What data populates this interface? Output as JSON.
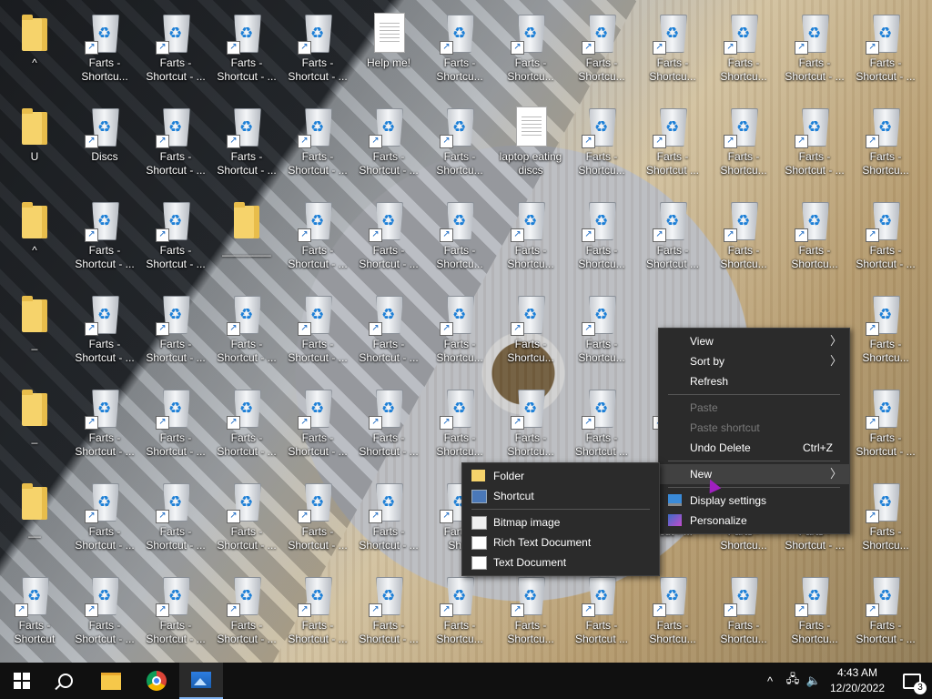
{
  "desktop": {
    "rows": [
      [
        {
          "type": "folder",
          "label": "^"
        },
        {
          "type": "bin",
          "label": "Farts -\nShortcu..."
        },
        {
          "type": "bin",
          "label": "Farts -\nShortcut - ..."
        },
        {
          "type": "bin",
          "label": "Farts -\nShortcut - ..."
        },
        {
          "type": "bin",
          "label": "Farts -\nShortcut - ..."
        },
        {
          "type": "doc",
          "label": "Help me!"
        },
        {
          "type": "bin",
          "label": "Farts -\nShortcu..."
        },
        {
          "type": "bin",
          "label": "Farts -\nShortcu..."
        },
        {
          "type": "bin",
          "label": "Farts -\nShortcu..."
        },
        {
          "type": "bin",
          "label": "Farts -\nShortcu..."
        },
        {
          "type": "bin",
          "label": "Farts -\nShortcu..."
        },
        {
          "type": "bin",
          "label": "Farts -\nShortcut - ..."
        },
        {
          "type": "bin",
          "label": "Farts -\nShortcut - ..."
        }
      ],
      [
        {
          "type": "folder",
          "label": "U"
        },
        {
          "type": "bin",
          "label": "Discs"
        },
        {
          "type": "bin",
          "label": "Farts -\nShortcut - ..."
        },
        {
          "type": "bin",
          "label": "Farts -\nShortcut - ..."
        },
        {
          "type": "bin",
          "label": "Farts -\nShortcut - ..."
        },
        {
          "type": "bin",
          "label": "Farts -\nShortcut - ..."
        },
        {
          "type": "bin",
          "label": "Farts -\nShortcu..."
        },
        {
          "type": "doc",
          "label": "laptop eating\ndiscs"
        },
        {
          "type": "bin",
          "label": "Farts -\nShortcu..."
        },
        {
          "type": "bin",
          "label": "Farts -\nShortcut ..."
        },
        {
          "type": "bin",
          "label": "Farts -\nShortcu..."
        },
        {
          "type": "bin",
          "label": "Farts -\nShortcut - ..."
        },
        {
          "type": "bin",
          "label": "Farts -\nShortcu..."
        }
      ],
      [
        {
          "type": "folder",
          "label": "^"
        },
        {
          "type": "bin",
          "label": "Farts -\nShortcut - ..."
        },
        {
          "type": "bin",
          "label": "Farts -\nShortcut - ..."
        },
        {
          "type": "folder",
          "label": "________"
        },
        {
          "type": "bin",
          "label": "Farts -\nShortcut - ..."
        },
        {
          "type": "bin",
          "label": "Farts -\nShortcut - ..."
        },
        {
          "type": "bin",
          "label": "Farts -\nShortcu..."
        },
        {
          "type": "bin",
          "label": "Farts -\nShortcu..."
        },
        {
          "type": "bin",
          "label": "Farts -\nShortcu..."
        },
        {
          "type": "bin",
          "label": "Farts -\nShortcut ..."
        },
        {
          "type": "bin",
          "label": "Farts -\nShortcu..."
        },
        {
          "type": "bin",
          "label": "Farts -\nShortcu..."
        },
        {
          "type": "bin",
          "label": "Farts -\nShortcut - ..."
        }
      ],
      [
        {
          "type": "folder",
          "label": "_"
        },
        {
          "type": "bin",
          "label": "Farts -\nShortcut - ..."
        },
        {
          "type": "bin",
          "label": "Farts -\nShortcut - ..."
        },
        {
          "type": "bin",
          "label": "Farts -\nShortcut - ..."
        },
        {
          "type": "bin",
          "label": "Farts -\nShortcut - ..."
        },
        {
          "type": "bin",
          "label": "Farts -\nShortcut - ..."
        },
        {
          "type": "bin",
          "label": "Farts -\nShortcu..."
        },
        {
          "type": "bin",
          "label": "Farts -\nShortcu..."
        },
        {
          "type": "bin",
          "label": "Farts -\nShortcu..."
        },
        null,
        null,
        null,
        {
          "type": "bin",
          "label": "Farts -\nShortcu..."
        }
      ],
      [
        {
          "type": "folder",
          "label": "_"
        },
        {
          "type": "bin",
          "label": "Farts -\nShortcut - ..."
        },
        {
          "type": "bin",
          "label": "Farts -\nShortcut - ..."
        },
        {
          "type": "bin",
          "label": "Farts -\nShortcut - ..."
        },
        {
          "type": "bin",
          "label": "Farts -\nShortcut - ..."
        },
        {
          "type": "bin",
          "label": "Farts -\nShortcut - ..."
        },
        {
          "type": "bin",
          "label": "Farts -\nShortcu..."
        },
        {
          "type": "bin",
          "label": "Farts -\nShortcu..."
        },
        {
          "type": "bin",
          "label": "Farts -\nShortcut ..."
        },
        {
          "type": "bin",
          "label": "S"
        },
        null,
        null,
        {
          "type": "bin",
          "label": "Farts -\nShortcut - ..."
        }
      ],
      [
        {
          "type": "folder",
          "label": "__"
        },
        {
          "type": "bin",
          "label": "Farts -\nShortcut - ..."
        },
        {
          "type": "bin",
          "label": "Farts -\nShortcut - ..."
        },
        {
          "type": "bin",
          "label": "Farts -\nShortcut - ..."
        },
        {
          "type": "bin",
          "label": "Farts -\nShortcut - ..."
        },
        {
          "type": "bin",
          "label": "Farts -\nShortcut - ..."
        },
        {
          "type": "bin",
          "label": "Farts -\nShor"
        },
        null,
        null,
        {
          "type": "bin",
          "label": "rtcut - ..."
        },
        {
          "type": "bin",
          "label": "Farts -\nShortcu..."
        },
        {
          "type": "bin",
          "label": "Farts -\nShortcut - ..."
        },
        {
          "type": "bin",
          "label": "Farts -\nShortcu..."
        }
      ],
      [
        {
          "type": "bin",
          "label": "Farts -\nShortcut"
        },
        {
          "type": "bin",
          "label": "Farts -\nShortcut - ..."
        },
        {
          "type": "bin",
          "label": "Farts -\nShortcut - ..."
        },
        {
          "type": "bin",
          "label": "Farts -\nShortcut - ..."
        },
        {
          "type": "bin",
          "label": "Farts -\nShortcut - ..."
        },
        {
          "type": "bin",
          "label": "Farts -\nShortcut - ..."
        },
        {
          "type": "bin",
          "label": "Farts -\nShortcu..."
        },
        {
          "type": "bin",
          "label": "Farts -\nShortcu..."
        },
        {
          "type": "bin",
          "label": "Farts -\nShortcut ..."
        },
        {
          "type": "bin",
          "label": "Farts -\nShortcu..."
        },
        {
          "type": "bin",
          "label": "Farts -\nShortcu..."
        },
        {
          "type": "bin",
          "label": "Farts -\nShortcu..."
        },
        {
          "type": "bin",
          "label": "Farts -\nShortcut - ..."
        }
      ]
    ]
  },
  "context_menu": {
    "view": "View",
    "sort_by": "Sort by",
    "refresh": "Refresh",
    "paste": "Paste",
    "paste_shortcut": "Paste shortcut",
    "undo_delete": "Undo Delete",
    "undo_shortcut": "Ctrl+Z",
    "new": "New",
    "display_settings": "Display settings",
    "personalize": "Personalize"
  },
  "new_submenu": {
    "folder": "Folder",
    "shortcut": "Shortcut",
    "bitmap": "Bitmap image",
    "rtf": "Rich Text Document",
    "text": "Text Document"
  },
  "taskbar": {
    "time": "4:43 AM",
    "date": "12/20/2022",
    "notification_count": "3",
    "tray_chevron": "^"
  }
}
